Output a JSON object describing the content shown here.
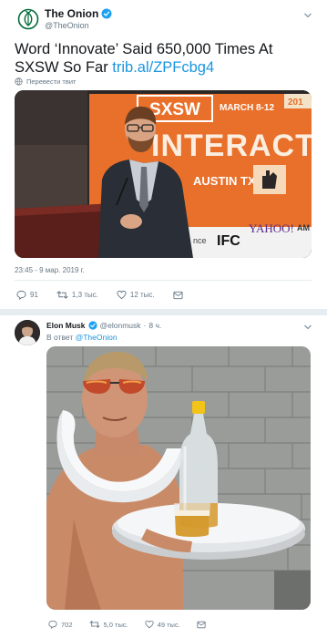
{
  "tweet1": {
    "author_name": "The Onion",
    "author_handle": "@TheOnion",
    "text": "Word ‘Innovate’ Said 650,000 Times At SXSW So Far ",
    "link": "trib.al/ZPFcbg4",
    "translate_label": "Перевести твит",
    "timestamp": "23:45 - 9 мар. 2019 г.",
    "photo_signage": {
      "sxsw": "SXSW",
      "dates": "MARCH 8-12",
      "year": "201",
      "interactive": "INTERACTIV",
      "location": "AUSTIN TX",
      "sponsor_ifc": "IFC",
      "sponsor_yahoo": "YAHOO!",
      "sponsor_partial": "nce",
      "sponsor_right": "AM"
    },
    "actions": {
      "replies": "91",
      "retweets": "1,3 тыс.",
      "likes": "12 тыс."
    }
  },
  "tweet2": {
    "author_name": "Elon Musk",
    "author_handle": "@elonmusk",
    "age": "8 ч.",
    "reply_prefix": "В ответ ",
    "reply_to": "@TheOnion",
    "actions": {
      "replies": "702",
      "retweets": "5,0 тыс.",
      "likes": "49 тыс."
    }
  },
  "colors": {
    "link": "#1b95e0",
    "onion_green": "#006b3a",
    "verified": "#1da1f2",
    "muted": "#657786",
    "divider": "#e6ecf0",
    "sxsw_orange": "#e8702a"
  }
}
